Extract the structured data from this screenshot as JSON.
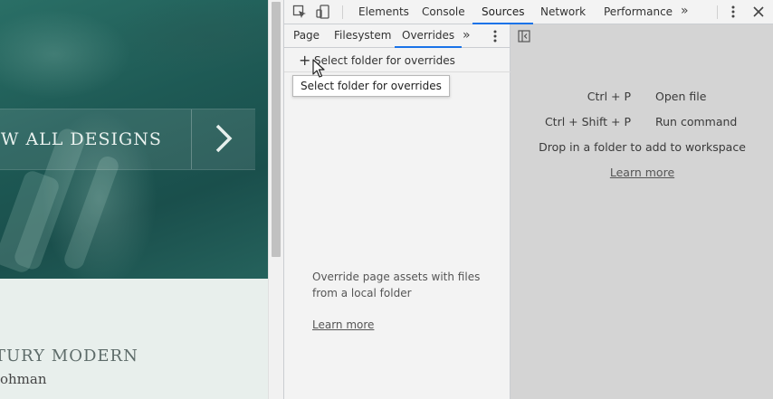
{
  "webpage": {
    "banner_text": "EW ALL DESIGNS",
    "section_title": "TURY MODERN",
    "author": "Lohman"
  },
  "devtools": {
    "main_tabs": [
      "Elements",
      "Console",
      "Sources",
      "Network",
      "Performance"
    ],
    "active_main_tab": "Sources",
    "more_tabs_glyph": "»",
    "sub_tabs": [
      "Page",
      "Filesystem",
      "Overrides"
    ],
    "active_sub_tab": "Overrides",
    "select_folder_label": "Select folder for overrides",
    "tooltip": "Select folder for overrides",
    "override_hint": "Override page assets with files from a local folder",
    "sidebar_learn_more": "Learn more",
    "shortcuts": [
      {
        "keys": "Ctrl + P",
        "label": "Open file"
      },
      {
        "keys": "Ctrl + Shift + P",
        "label": "Run command"
      }
    ],
    "drop_text": "Drop in a folder to add to workspace",
    "editor_learn_more": "Learn more",
    "accent_color": "#1a73e8"
  }
}
